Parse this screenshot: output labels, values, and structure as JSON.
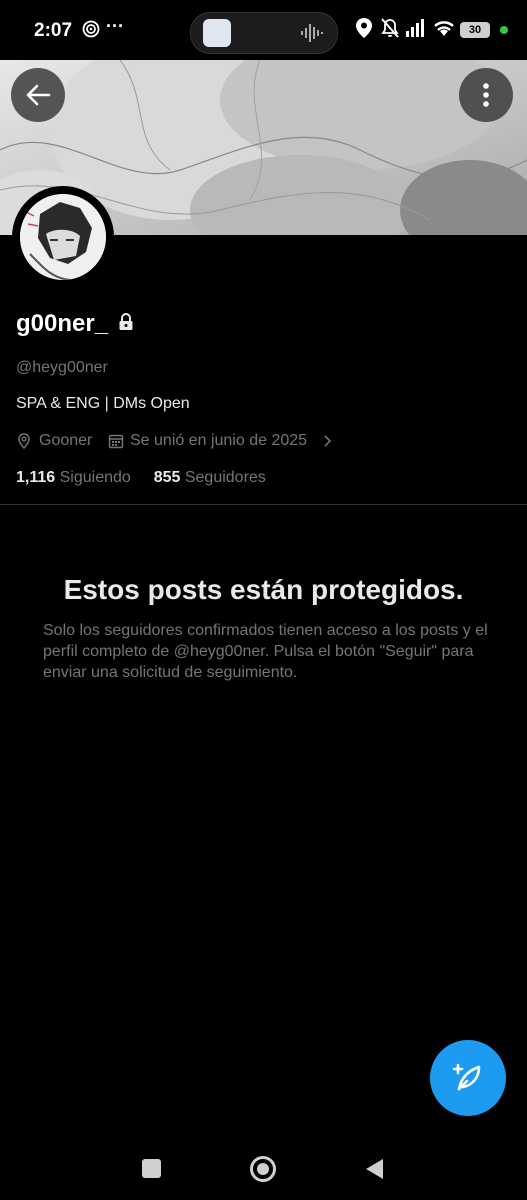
{
  "status_bar": {
    "time": "2:07",
    "battery": "30",
    "dot_color": "#2ecc40"
  },
  "profile": {
    "display_name": "g00ner_",
    "handle": "@heyg00ner",
    "bio": "SPA & ENG | DMs Open",
    "location": "Gooner",
    "joined": "Se unió en junio de 2025",
    "following_count": "1,116",
    "following_label": "Siguiendo",
    "followers_count": "855",
    "followers_label": "Seguidores"
  },
  "protected": {
    "title": "Estos posts están protegidos.",
    "description": "Solo los seguidores confirmados tienen acceso a los posts y el perfil completo de @heyg00ner. Pulsa el botón \"Seguir\" para enviar una solicitud de seguimiento."
  },
  "colors": {
    "accent": "#1d9bf0",
    "background": "#000000",
    "muted_text": "#71767b"
  },
  "icons": {
    "back": "arrow-left-icon",
    "more": "more-vertical-icon",
    "lock": "lock-icon",
    "location": "location-pin-icon",
    "calendar": "calendar-icon",
    "compose": "compose-feather-icon"
  }
}
